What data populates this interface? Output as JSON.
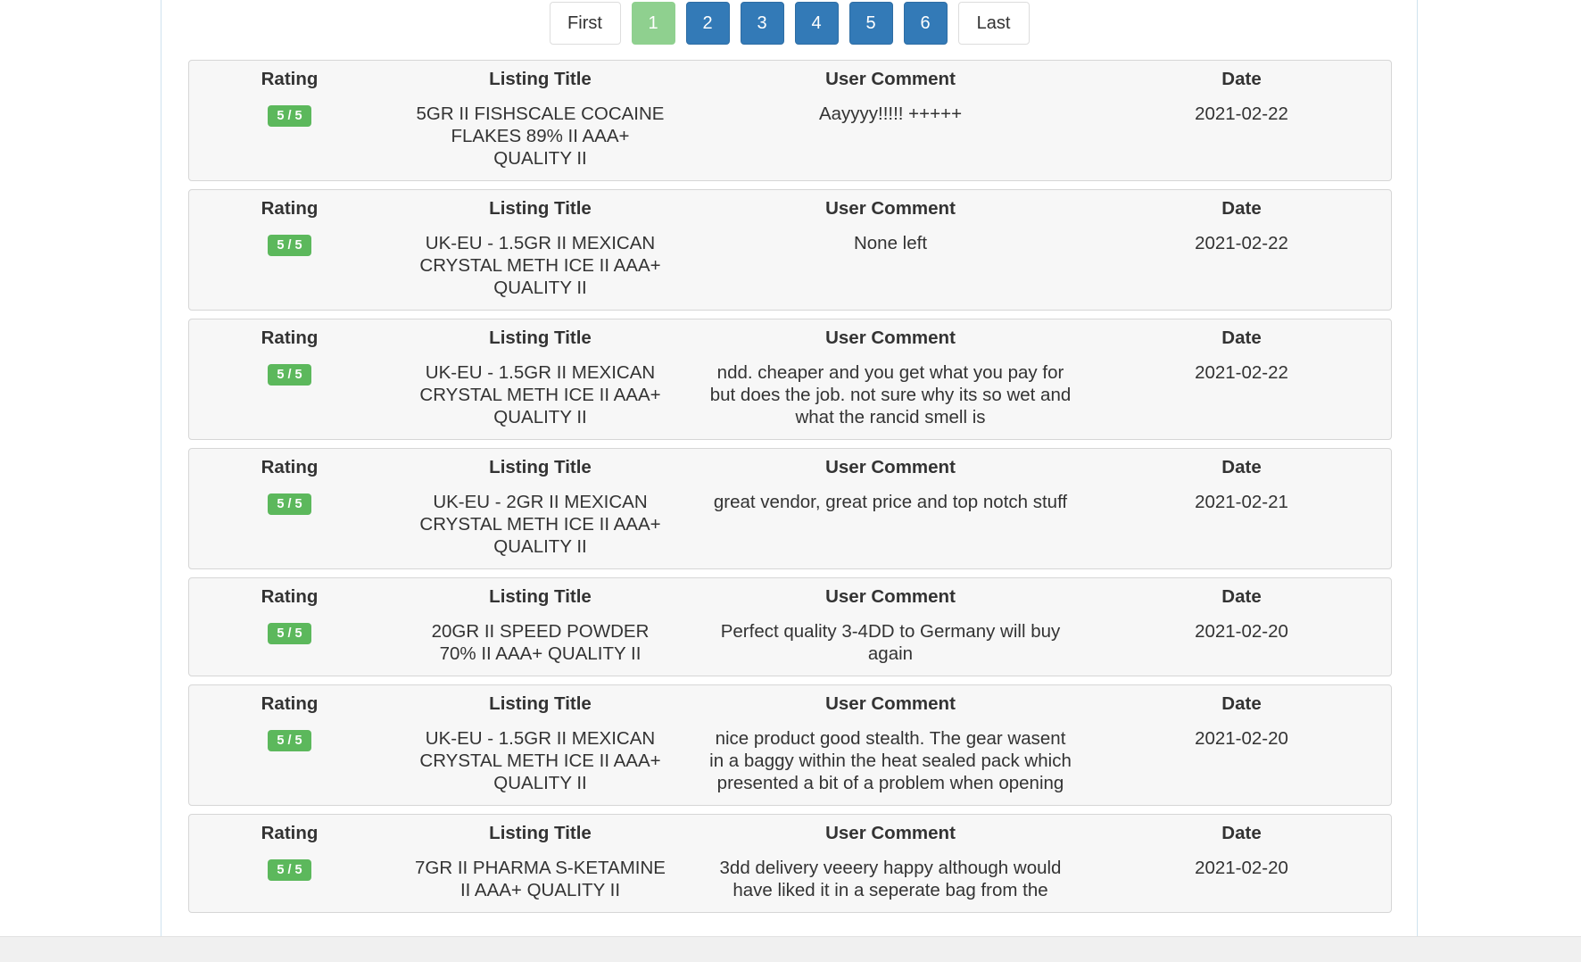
{
  "pagination": {
    "first_label": "First",
    "pages": [
      "1",
      "2",
      "3",
      "4",
      "5",
      "6"
    ],
    "active_page": "1",
    "last_label": "Last"
  },
  "column_headers": {
    "rating": "Rating",
    "listing_title": "Listing Title",
    "user_comment": "User Comment",
    "date": "Date"
  },
  "reviews": [
    {
      "rating": "5 / 5",
      "listing_title": "5GR II FISHSCALE COCAINE FLAKES 89% II AAA+ QUALITY II",
      "user_comment": "Aayyyy!!!!! +++++",
      "date": "2021-02-22"
    },
    {
      "rating": "5 / 5",
      "listing_title": "UK-EU - 1.5GR II MEXICAN CRYSTAL METH ICE II AAA+ QUALITY II",
      "user_comment": "None left",
      "date": "2021-02-22"
    },
    {
      "rating": "5 / 5",
      "listing_title": "UK-EU - 1.5GR II MEXICAN CRYSTAL METH ICE II AAA+ QUALITY II",
      "user_comment": "ndd. cheaper and you get what you pay for but does the job. not sure why its so wet and what the rancid smell is",
      "date": "2021-02-22"
    },
    {
      "rating": "5 / 5",
      "listing_title": "UK-EU - 2GR II MEXICAN CRYSTAL METH ICE II AAA+ QUALITY II",
      "user_comment": "great vendor, great price and top notch stuff",
      "date": "2021-02-21"
    },
    {
      "rating": "5 / 5",
      "listing_title": "20GR II SPEED POWDER 70% II AAA+ QUALITY II",
      "user_comment": "Perfect quality 3-4DD to Germany will buy again",
      "date": "2021-02-20"
    },
    {
      "rating": "5 / 5",
      "listing_title": "UK-EU - 1.5GR II MEXICAN CRYSTAL METH ICE II AAA+ QUALITY II",
      "user_comment": "nice product good stealth. The gear wasent in a baggy within the heat sealed pack which presented a bit of a problem when opening",
      "date": "2021-02-20"
    },
    {
      "rating": "5 / 5",
      "listing_title": "7GR II PHARMA S-KETAMINE II AAA+ QUALITY II",
      "user_comment": "3dd delivery veeery happy although would have liked it in a seperate bag from the",
      "date": "2021-02-20"
    }
  ],
  "colors": {
    "page_button_blue": "#337ab7",
    "page_button_active": "#8fd08f",
    "rating_badge_green": "#5cb85c"
  }
}
